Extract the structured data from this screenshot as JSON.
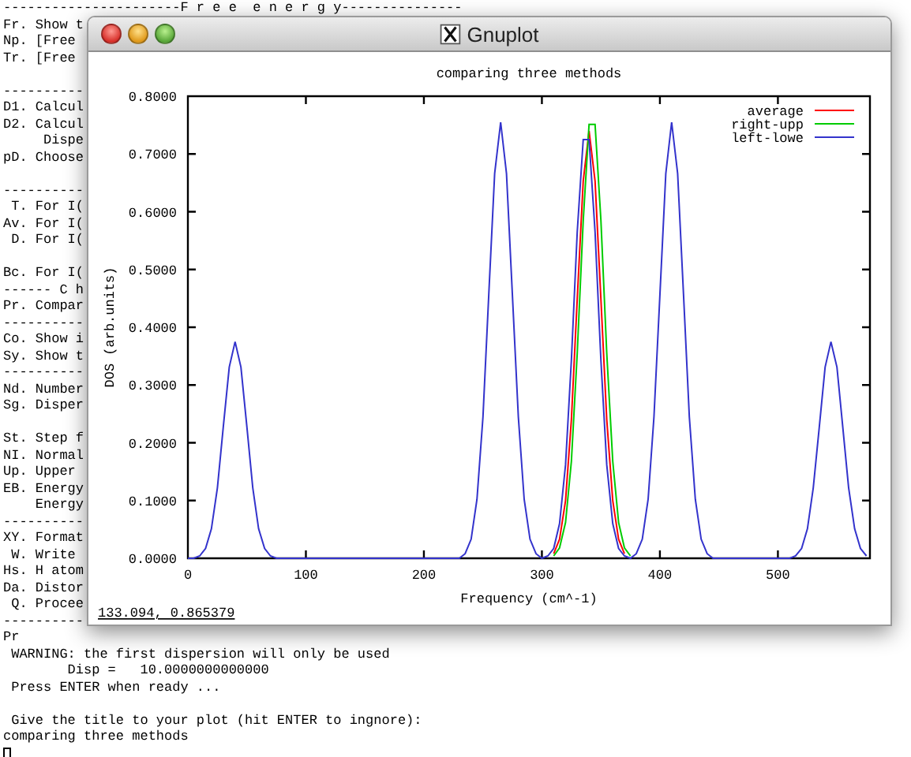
{
  "terminal": {
    "blocks": [
      [
        "----------------------F r e e  e n e r g y---------------",
        "Fr. Show t",
        "Np. [Free",
        "Tr. [Free"
      ],
      [
        "----------",
        "D1. Calcul",
        "D2. Calcul",
        "     Dispe",
        "pD. Choose"
      ],
      [
        "----------",
        " T. For I(",
        "Av. For I(",
        " D. For I("
      ],
      [
        "Bc. For I(",
        "------ C h",
        "Pr. Compar",
        "----------",
        "Co. Show i",
        "Sy. Show t",
        "----------",
        "Nd. Number",
        "Sg. Disper"
      ],
      [
        "St. Step f",
        "NI. Normal",
        "Up. Upper",
        "EB. Energy",
        "    Energy",
        "----------",
        "XY. Format",
        " W. Write",
        "Hs. H atom",
        "Da. Distor",
        " Q. Procee",
        "----------",
        "Pr",
        " WARNING: the first dispersion will only be used",
        "        Disp =   10.0000000000000",
        " Press ENTER when ready ..."
      ],
      [
        " Give the title to your plot (hit ENTER to ingnore):",
        "comparing three methods"
      ]
    ]
  },
  "gnuplot": {
    "window": {
      "title": "Gnuplot"
    },
    "chart_data": {
      "type": "line",
      "title": "comparing three methods",
      "xlabel": "Frequency (cm^-1)",
      "ylabel": "DOS (arb.units)",
      "x": [
        0,
        5,
        10,
        15,
        20,
        25,
        30,
        35,
        40,
        45,
        50,
        55,
        60,
        65,
        70,
        75,
        230,
        235,
        240,
        245,
        250,
        255,
        260,
        265,
        270,
        275,
        280,
        285,
        290,
        295,
        300,
        305,
        310,
        315,
        320,
        325,
        330,
        335,
        340,
        345,
        350,
        355,
        360,
        365,
        370,
        375,
        380,
        385,
        390,
        395,
        400,
        405,
        410,
        415,
        420,
        425,
        430,
        435,
        440,
        445,
        505,
        510,
        515,
        520,
        525,
        530,
        535,
        540,
        545,
        550,
        555,
        560,
        565,
        570,
        575
      ],
      "series": [
        {
          "name": "average",
          "color": "#ff0000",
          "values": [
            null,
            null,
            null,
            null,
            null,
            null,
            null,
            null,
            null,
            null,
            null,
            null,
            null,
            null,
            null,
            null,
            null,
            null,
            null,
            null,
            null,
            null,
            null,
            null,
            null,
            null,
            null,
            null,
            null,
            null,
            null,
            null,
            0.008,
            0.033,
            0.1,
            0.24,
            0.449,
            0.653,
            0.74,
            0.653,
            0.449,
            0.24,
            0.1,
            0.033,
            0.008,
            null,
            null,
            null,
            null,
            null,
            null,
            null,
            null,
            null,
            null,
            null,
            null,
            null,
            null,
            null,
            null,
            null,
            null,
            null,
            null,
            null,
            null,
            null,
            null,
            null,
            null,
            null,
            null,
            null,
            null
          ]
        },
        {
          "name": "right-upp",
          "color": "#00cc00",
          "values": [
            null,
            null,
            null,
            null,
            null,
            null,
            null,
            null,
            null,
            null,
            null,
            null,
            null,
            null,
            null,
            null,
            null,
            null,
            null,
            null,
            null,
            null,
            null,
            null,
            null,
            null,
            null,
            null,
            null,
            null,
            null,
            null,
            0.004,
            0.018,
            0.062,
            0.168,
            0.355,
            0.585,
            0.751,
            0.751,
            0.585,
            0.355,
            0.168,
            0.062,
            0.018,
            0.004,
            null,
            null,
            null,
            null,
            null,
            null,
            null,
            null,
            null,
            null,
            null,
            null,
            null,
            null,
            null,
            null,
            null,
            null,
            null,
            null,
            null,
            null,
            null,
            null,
            null,
            null,
            null,
            null,
            null
          ]
        },
        {
          "name": "left-lowe",
          "color": "#3333cc",
          "values": [
            0,
            0,
            0.004,
            0.017,
            0.051,
            0.122,
            0.227,
            0.331,
            0.375,
            0.331,
            0.227,
            0.122,
            0.051,
            0.017,
            0.004,
            0,
            0,
            0.008,
            0.033,
            0.102,
            0.245,
            0.458,
            0.666,
            0.755,
            0.666,
            0.458,
            0.245,
            0.102,
            0.033,
            0.008,
            0,
            0.004,
            0.017,
            0.06,
            0.162,
            0.343,
            0.565,
            0.725,
            0.725,
            0.565,
            0.343,
            0.162,
            0.06,
            0.017,
            0.004,
            0,
            0.008,
            0.033,
            0.102,
            0.245,
            0.458,
            0.666,
            0.755,
            0.666,
            0.458,
            0.245,
            0.102,
            0.033,
            0.008,
            0,
            0,
            0,
            0.004,
            0.017,
            0.051,
            0.122,
            0.227,
            0.331,
            0.375,
            0.331,
            0.227,
            0.122,
            0.051,
            0.017,
            0.004
          ]
        }
      ],
      "legend": "upper right",
      "xlim": [
        0,
        578
      ],
      "ylim": [
        0,
        0.8
      ],
      "xticks": [
        0,
        100,
        200,
        300,
        400,
        500
      ],
      "yticks": [
        {
          "value": 0,
          "label": "0.0000"
        },
        {
          "value": 0.1,
          "label": "0.1000"
        },
        {
          "value": 0.2,
          "label": "0.2000"
        },
        {
          "value": 0.3,
          "label": "0.3000"
        },
        {
          "value": 0.4,
          "label": "0.4000"
        },
        {
          "value": 0.5,
          "label": "0.5000"
        },
        {
          "value": 0.6,
          "label": "0.6000"
        },
        {
          "value": 0.7,
          "label": "0.7000"
        },
        {
          "value": 0.8,
          "label": "0.8000"
        }
      ]
    },
    "cursor_readout": "133.094,  0.865379"
  }
}
